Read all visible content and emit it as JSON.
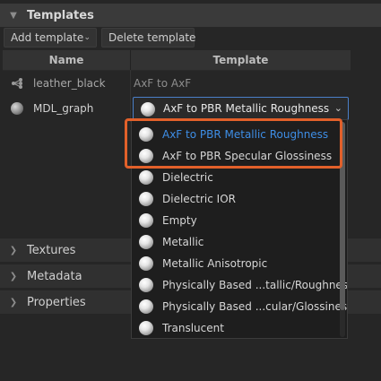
{
  "panel": {
    "templates_title": "Templates",
    "textures_title": "Textures",
    "metadata_title": "Metadata",
    "properties_title": "Properties"
  },
  "toolbar": {
    "add_label": "Add template",
    "delete_label": "Delete template"
  },
  "table": {
    "columns": [
      "Name",
      "Template"
    ],
    "rows": [
      {
        "name": "leather_black",
        "template": "AxF to AxF",
        "icon": "node-graph-icon"
      },
      {
        "name": "MDL_graph",
        "template": "AxF to PBR Metallic Roughness",
        "icon": "material-sphere-icon"
      }
    ]
  },
  "dropdown": {
    "selected": "AxF to PBR Metallic Roughness",
    "options": [
      "AxF to PBR Metallic Roughness",
      "AxF to PBR Specular Glossiness",
      "Dielectric",
      "Dielectric IOR",
      "Empty",
      "Metallic",
      "Metallic Anisotropic",
      "Physically Based ...tallic/Roughness)",
      "Physically Based ...cular/Glossiness)",
      "Translucent"
    ]
  },
  "colors": {
    "selected_text": "#3e8ee6",
    "highlight_border": "#e2602a",
    "combo_border": "#4a7fc8"
  }
}
